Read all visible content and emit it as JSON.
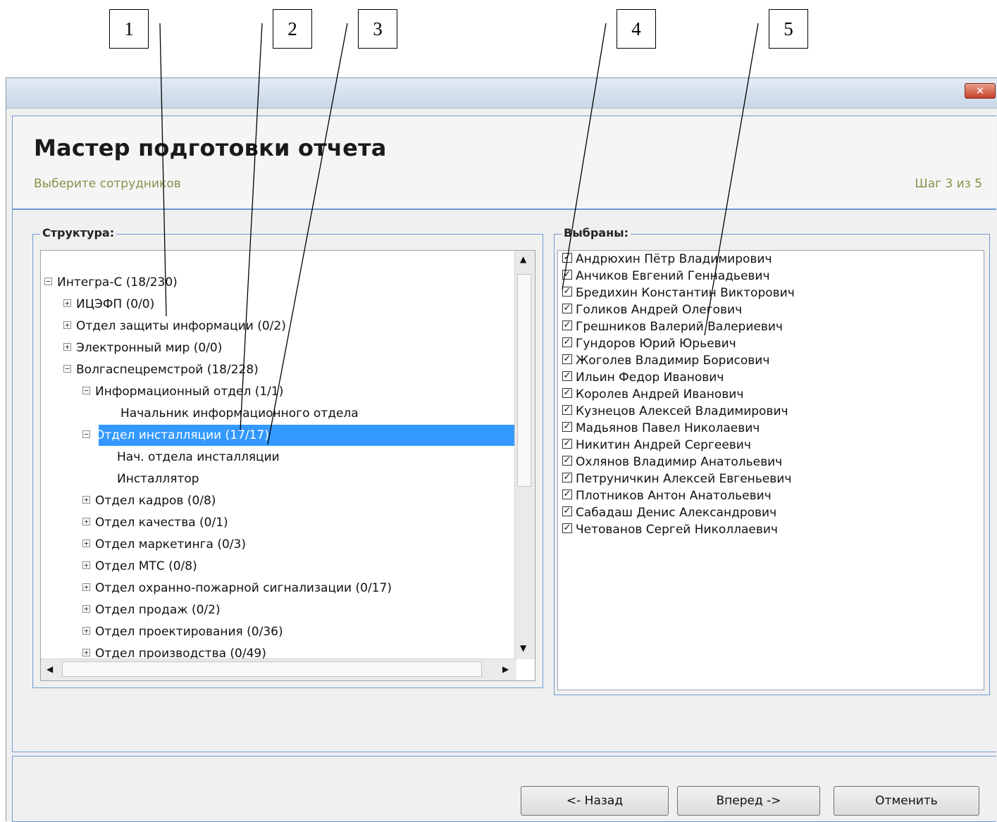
{
  "callouts": [
    "1",
    "2",
    "3",
    "4",
    "5"
  ],
  "window": {
    "close_glyph": "✕",
    "title": "Мастер подготовки отчета",
    "subtitle": "Выберите сотрудников",
    "step": "Шаг 3 из 5"
  },
  "structure": {
    "legend": "Структура:",
    "items": [
      {
        "label": "Интегра-С (18/230)",
        "expander": "−"
      },
      {
        "label": "ИЦЭФП (0/0)",
        "expander": "+"
      },
      {
        "label": "Отдел  защиты информации (0/2)",
        "expander": "+"
      },
      {
        "label": "Электронный мир (0/0)",
        "expander": "+"
      },
      {
        "label": "Волгаспецремстрой (18/228)",
        "expander": "−"
      },
      {
        "label": "Информационный отдел (1/1)",
        "expander": "−"
      },
      {
        "label": "Начальник информационного отдела",
        "expander": ""
      },
      {
        "label": "Отдел инсталляции (17/17)",
        "expander": "−",
        "selected": true
      },
      {
        "label": "Нач. отдела инсталляции",
        "expander": ""
      },
      {
        "label": "Инсталлятор",
        "expander": ""
      },
      {
        "label": "Отдел кадров (0/8)",
        "expander": "+"
      },
      {
        "label": "Отдел качества (0/1)",
        "expander": "+"
      },
      {
        "label": "Отдел маркетинга (0/3)",
        "expander": "+"
      },
      {
        "label": "Отдел МТС (0/8)",
        "expander": "+"
      },
      {
        "label": "Отдел охранно-пожарной сигнализации (0/17)",
        "expander": "+"
      },
      {
        "label": "Отдел продаж (0/2)",
        "expander": "+"
      },
      {
        "label": "Отдел проектирования (0/36)",
        "expander": "+"
      },
      {
        "label": "Отдел производства (0/49)",
        "expander": "+"
      }
    ]
  },
  "selected": {
    "legend": "Выбраны:",
    "items": [
      "Андрюхин Пётр Владимирович",
      "Анчиков Евгений Геннадьевич",
      "Бредихин Константин Викторович",
      "Голиков Андрей Олегович",
      "Грешников Валерий Валериевич",
      "Гундоров Юрий Юрьевич",
      "Жоголев Владимир Борисович",
      "Ильин Федор Иванович",
      "Королев Андрей Иванович",
      "Кузнецов Алексей Владимирович",
      "Мадьянов Павел Николаевич",
      "Никитин Андрей Сергеевич",
      "Охлянов Владимир Анатольевич",
      "Петруничкин Алексей Евгеньевич",
      "Плотников Антон Анатольевич",
      "Сабадаш Денис Александрович",
      "Четованов Сергей Николлаевич"
    ]
  },
  "buttons": {
    "back": "<- Назад",
    "next": "Вперед ->",
    "cancel": "Отменить"
  }
}
